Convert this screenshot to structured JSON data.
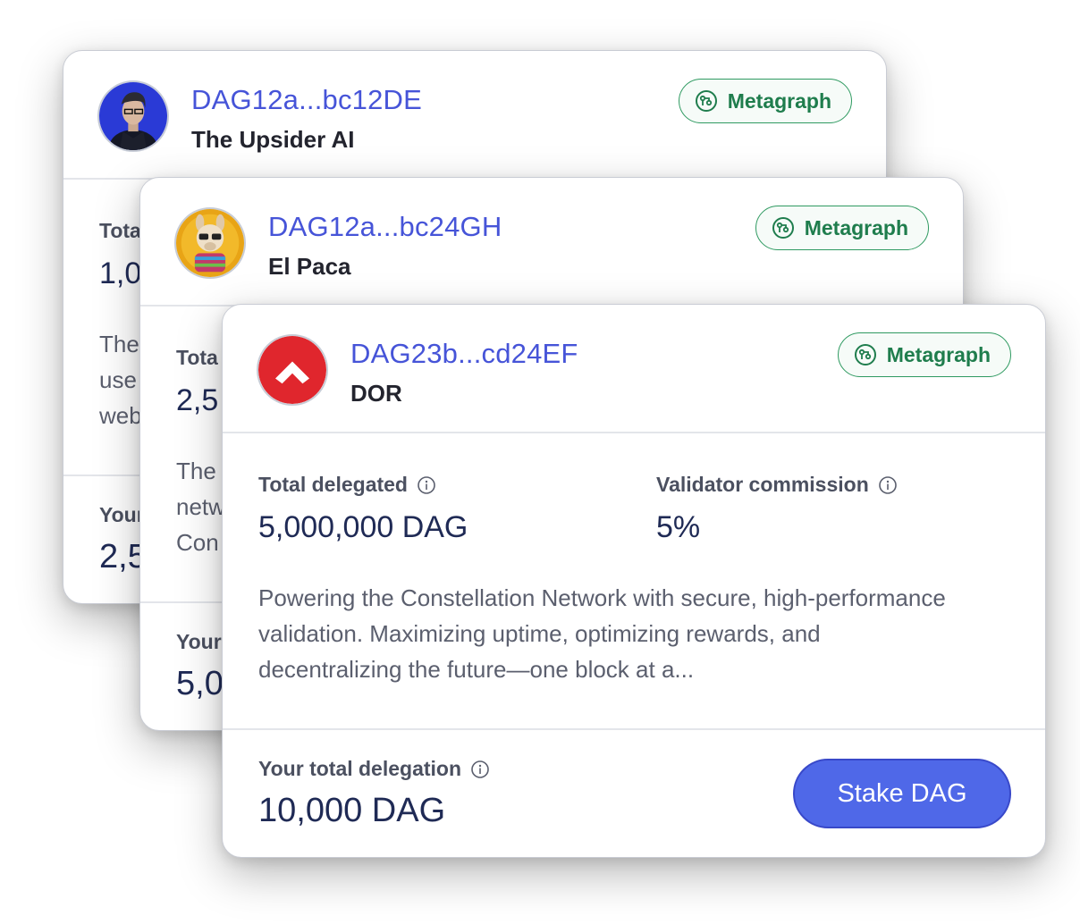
{
  "cards": [
    {
      "address": "DAG12a...bc12DE",
      "name": "The Upsider AI",
      "badge": "Metagraph",
      "avatar_icon": "avatar-upsider-ai",
      "total_delegated_label": "Tota",
      "total_delegated_value": "1,0",
      "description": "The\nuse\nweb",
      "your_total_label": "Your",
      "your_total_value": "2,5"
    },
    {
      "address": "DAG12a...bc24GH",
      "name": "El Paca",
      "badge": "Metagraph",
      "avatar_icon": "avatar-el-paca",
      "total_delegated_label": "Tota",
      "total_delegated_value": "2,5",
      "description": "The\nnetw\nCon",
      "your_total_label": "Your",
      "your_total_value": "5,0"
    },
    {
      "address": "DAG23b...cd24EF",
      "name": "DOR",
      "badge": "Metagraph",
      "avatar_icon": "avatar-dor-logo",
      "total_delegated_label": "Total delegated",
      "total_delegated_value": "5,000,000 DAG",
      "commission_label": "Validator commission",
      "commission_value": "5%",
      "description": "Powering the Constellation Network with secure, high-performance validation. Maximizing uptime, optimizing rewards, and decentralizing the future—one block at a...",
      "your_total_label": "Your total delegation",
      "your_total_value": "10,000 DAG",
      "stake_button": "Stake DAG"
    }
  ],
  "colors": {
    "address": "#4654d8",
    "badge_green": "#1f7d4d",
    "button": "#4f68e8",
    "value_navy": "#1f2a55",
    "dor_red": "#e0262d"
  }
}
